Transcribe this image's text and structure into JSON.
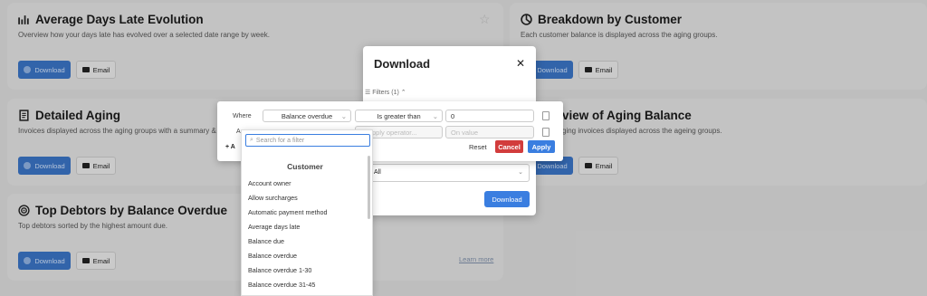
{
  "cards": {
    "c1": {
      "title": "Average Days Late Evolution",
      "desc": "Overview how your days late has evolved over a selected date range by week."
    },
    "c2": {
      "title": "Breakdown by Customer",
      "desc": "Each customer balance is displayed across the aging groups."
    },
    "c3": {
      "title": "Detailed Aging",
      "desc": "Invoices displayed across the aging groups with a summary &"
    },
    "c4": {
      "title": "view of Aging Balance",
      "desc": "ging invoices displayed across the ageing groups."
    },
    "c5": {
      "title": "Top Debtors by Balance Overdue",
      "desc": "Top debtors sorted by the highest amount due."
    },
    "download_label": "Download",
    "email_label": "Email",
    "learn_more": "Learn more"
  },
  "modal": {
    "title": "Download",
    "close": "✕",
    "filters_label": "Filters (1)",
    "select_value": "All",
    "download_button": "Download"
  },
  "filter": {
    "where_label": "Where",
    "and_label": "A",
    "add_label": "+ A",
    "field": "Balance overdue",
    "operator": "Is greater than",
    "value": "0",
    "operator_placeholder": "pply operator...",
    "value_placeholder": "On value",
    "reset": "Reset",
    "cancel": "Cancel",
    "apply": "Apply"
  },
  "dropdown": {
    "search_placeholder": "Search for a filter",
    "group": "Customer",
    "items": [
      "Account owner",
      "Allow surcharges",
      "Automatic payment method",
      "Average days late",
      "Balance due",
      "Balance overdue",
      "Balance overdue 1-30",
      "Balance overdue 31-45"
    ]
  }
}
